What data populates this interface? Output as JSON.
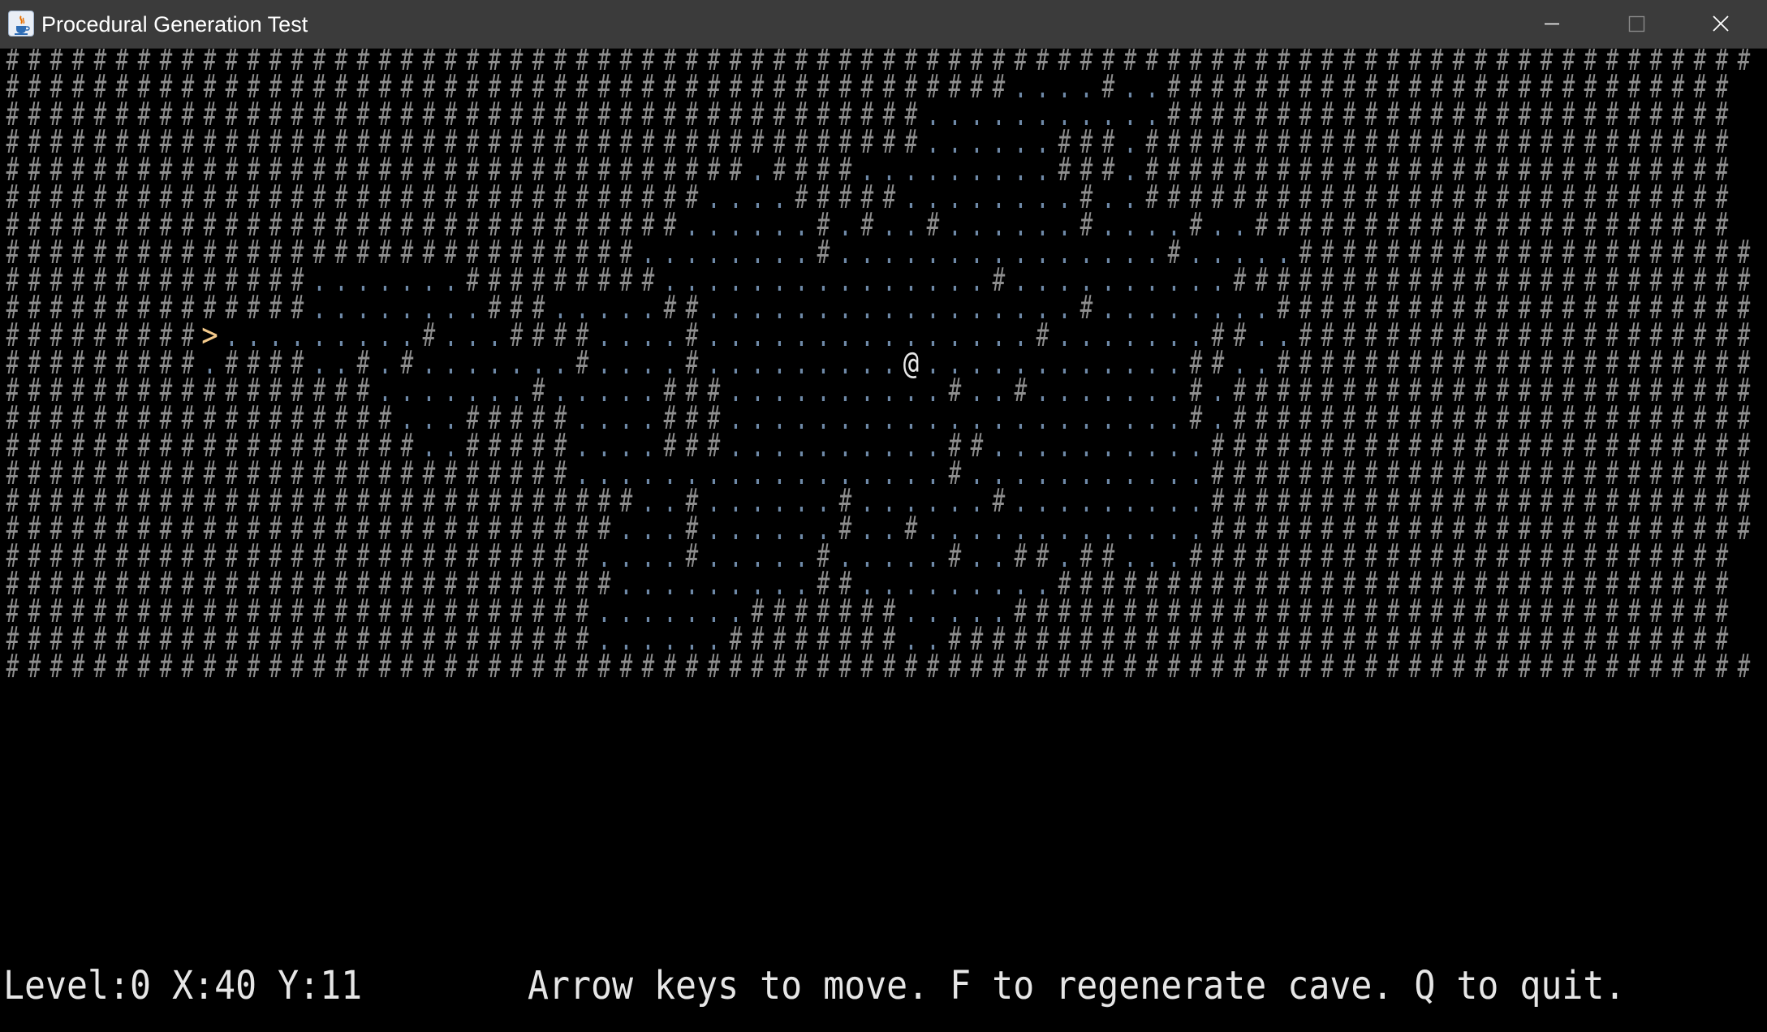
{
  "window": {
    "title": "Procedural Generation Test",
    "icon": "java-cup-icon",
    "controls": [
      "minimize-icon",
      "maximize-icon",
      "close-icon"
    ]
  },
  "colors": {
    "background": "#000000",
    "titlebar": "#3b3b3b",
    "wall": "#8e8e8e",
    "floor": "#6f8aa8",
    "player": "#e8e8e8",
    "stairs": "#f3c98b",
    "status_text": "#e6e6e6"
  },
  "map": {
    "rows": [
      "################################################################################",
      "##############################################....#..##########################",
      "##########################################...........##########################",
      "##########################################......###.###########################",
      "##################################.####.........###.###########################",
      "################################....#####........#..###########################",
      "###############################......#.#..#......#....#..######################",
      "#############################........#...............#.....#####################",
      "##############.......#########...............#..........########################",
      "##############........###.....##.................#........######################",
      "#########>.........#...####....#...............#.......##..#####################",
      "#########.####..#.#.......#....#.........@............##..######################",
      "#################.......#.....###..........#..#.......#.########################",
      "##################...#####....###.....................#.########################",
      "###################..#####....###..........##..........#########################",
      "##########################.................#...........#########################",
      "#############################..#......#......#.........#########################",
      "############################...#......#..#.............#########################",
      "###########################....#.....#.....#..##.##...#########################",
      "############################.........##.........###############################",
      "###########################.......#######.....#################################",
      "###########################......########..####################################",
      "################################################################################"
    ],
    "player_glyph": "@",
    "stairs_glyph": ">"
  },
  "status": {
    "level_text": "Level:0 X:40 Y:11",
    "help_text": "Arrow keys to move. F to regenerate cave. Q to quit."
  }
}
